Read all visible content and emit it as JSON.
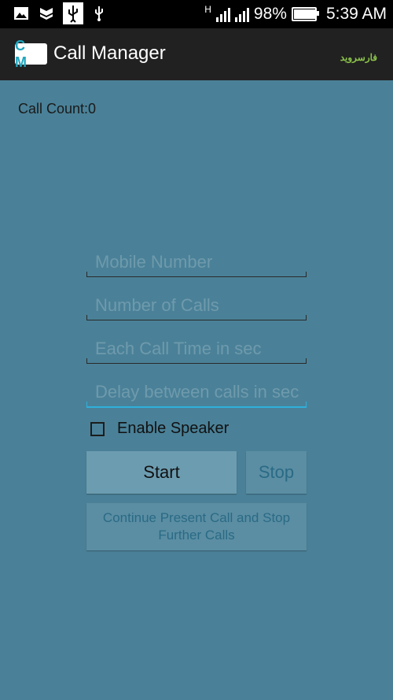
{
  "status_bar": {
    "network_type": "H",
    "battery_percent_text": "98%",
    "battery_level": 0.98,
    "time": "5:39 AM",
    "left_icons": [
      "image-icon",
      "shield-icon",
      "usb-debug-icon",
      "usb-icon"
    ]
  },
  "app_bar": {
    "logo_text": "C M",
    "title": "Call Manager",
    "watermark": "فارسروید"
  },
  "call_count_label": "Call Count:0",
  "form": {
    "mobile_number_placeholder": "Mobile Number",
    "number_of_calls_placeholder": "Number of Calls",
    "each_call_time_placeholder": "Each Call Time in sec",
    "delay_placeholder": "Delay between calls in sec",
    "enable_speaker_label": "Enable Speaker",
    "enable_speaker_checked": false
  },
  "buttons": {
    "start": "Start",
    "stop": "Stop",
    "continue": "Continue Present Call and Stop Further Calls"
  },
  "colors": {
    "background": "#4a8198",
    "app_bar": "#212121",
    "accent": "#2fb0dd",
    "button": "#6c9cb0"
  }
}
